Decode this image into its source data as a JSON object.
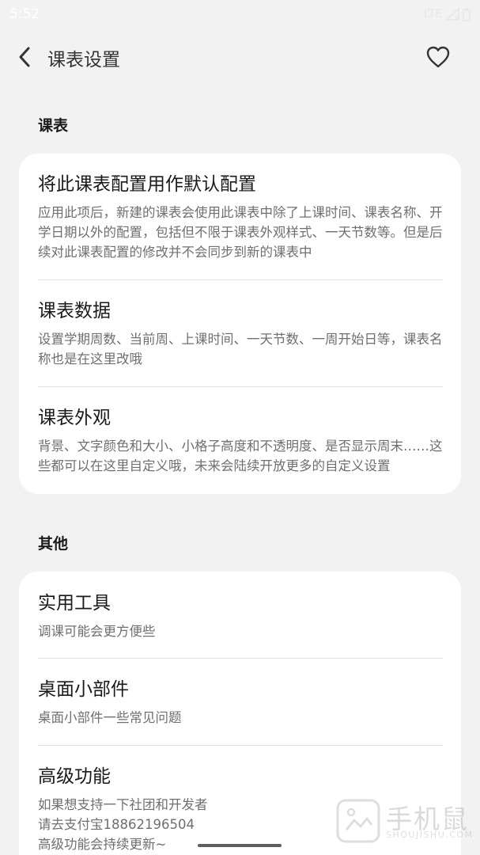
{
  "status_bar": {
    "time": "5:52",
    "network": "LTE"
  },
  "header": {
    "title": "课表设置"
  },
  "sections": [
    {
      "title": "课表",
      "items": [
        {
          "title": "将此课表配置用作默认配置",
          "desc": "应用此项后，新建的课表会使用此课表中除了上课时间、课表名称、开学日期以外的配置，包括但不限于课表外观样式、一天节数等。但是后续对此课表配置的修改并不会同步到新的课表中"
        },
        {
          "title": "课表数据",
          "desc": "设置学期周数、当前周、上课时间、一天节数、一周开始日等，课表名称也是在这里改哦"
        },
        {
          "title": "课表外观",
          "desc": "背景、文字颜色和大小、小格子高度和不透明度、是否显示周末……这些都可以在这里自定义哦，未来会陆续开放更多的自定义设置"
        }
      ]
    },
    {
      "title": "其他",
      "items": [
        {
          "title": "实用工具",
          "desc": "调课可能会更方便些"
        },
        {
          "title": "桌面小部件",
          "desc": "桌面小部件一些常见问题"
        },
        {
          "title": "高级功能",
          "desc": "如果想支持一下社团和开发者\n请去支付宝18862196504\n高级功能会持续更新~"
        }
      ]
    }
  ],
  "watermark": {
    "text": "手机鼠",
    "sub": "SHOUJISHU.COM"
  },
  "icons": {
    "back": "chevron-left-icon",
    "favorite": "heart-outline-icon"
  }
}
